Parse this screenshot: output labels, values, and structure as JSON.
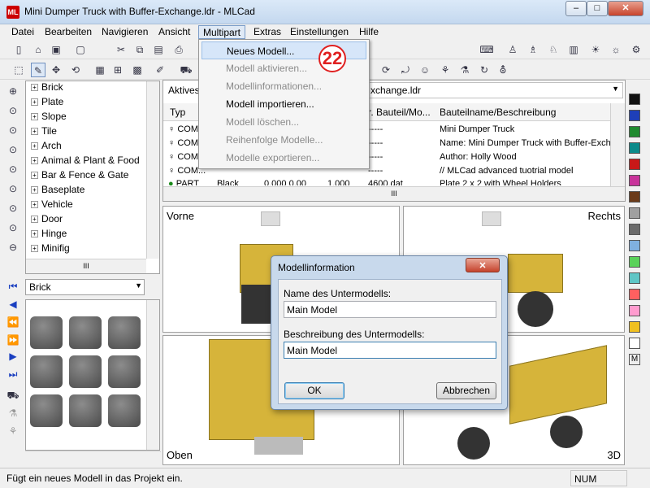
{
  "window": {
    "title": "Mini Dumper Truck with Buffer-Exchange.ldr - MLCad",
    "min": "–",
    "max": "□",
    "close": "✕"
  },
  "menu": [
    "Datei",
    "Bearbeiten",
    "Navigieren",
    "Ansicht",
    "Multipart",
    "Extras",
    "Einstellungen",
    "Hilfe"
  ],
  "dropdown": {
    "items": [
      {
        "label": "Neues Modell...",
        "enabled": true
      },
      {
        "label": "Modell aktivieren...",
        "enabled": false
      },
      {
        "label": "Modellinformationen...",
        "enabled": false
      },
      {
        "label": "Modell importieren...",
        "enabled": true
      },
      {
        "label": "Modell löschen...",
        "enabled": false
      },
      {
        "label": "Reihenfolge Modelle...",
        "enabled": false
      },
      {
        "label": "Modelle exportieren...",
        "enabled": false
      }
    ],
    "badge": "22"
  },
  "tree": [
    "Brick",
    "Plate",
    "Slope",
    "Tile",
    "Arch",
    "Animal & Plant & Food",
    "Bar & Fence & Gate",
    "Baseplate",
    "Vehicle",
    "Door",
    "Hinge",
    "Minifig"
  ],
  "tree_scroll_label": "III",
  "part_category": "Brick",
  "model_panel": {
    "active_label": "Aktives",
    "active_value": "xchange.ldr",
    "headers": {
      "type": "Typ",
      "part_no": "r. Bauteil/Mo...",
      "desc": "Bauteilname/Beschreibung"
    },
    "rows": [
      {
        "type": "COM",
        "c2": "",
        "c3": "",
        "c4": "",
        "part": "-----",
        "desc": "Mini Dumper Truck"
      },
      {
        "type": "COM",
        "c2": "",
        "c3": "",
        "c4": "",
        "part": "-----",
        "desc": "Name: Mini Dumper Truck with Buffer-Excha"
      },
      {
        "type": "COM",
        "c2": "",
        "c3": "",
        "c4": "",
        "part": "-----",
        "desc": "Author: Holly Wood"
      },
      {
        "type": "COM...",
        "c2": "",
        "c3": "",
        "c4": "",
        "part": "-----",
        "desc": "// MLCad advanced tuotrial model"
      },
      {
        "type": "PART",
        "c2": "Black",
        "c3": "0.000 0.00",
        "c4": "1.000",
        "part": "4600.dat",
        "desc": "Plate 2 x 2 with Wheel Holders"
      }
    ],
    "hscroll_label": "III"
  },
  "views": {
    "front": "Vorne",
    "right": "Rechts",
    "top": "Oben",
    "threed": "3D"
  },
  "dialog": {
    "title": "Modellinformation",
    "close": "✕",
    "name_label": "Name des Untermodells:",
    "name_value": "Main Model",
    "desc_label": "Beschreibung des Untermodells:",
    "desc_value": "Main Model",
    "ok": "OK",
    "cancel": "Abbrechen"
  },
  "colors": [
    "#111111",
    "#1e3fb8",
    "#1f8a2f",
    "#0a8a8a",
    "#c81818",
    "#c8339a",
    "#6b3b1a",
    "#a0a0a0",
    "#6a6a6a",
    "#7fb0e0",
    "#5ad25a",
    "#5fc6c6",
    "#ff6060",
    "#ff9ccf",
    "#f0c020",
    "#ffffff"
  ],
  "color_last": "M",
  "status": {
    "text": "Fügt ein neues Modell in das Projekt ein.",
    "num": "NUM"
  }
}
